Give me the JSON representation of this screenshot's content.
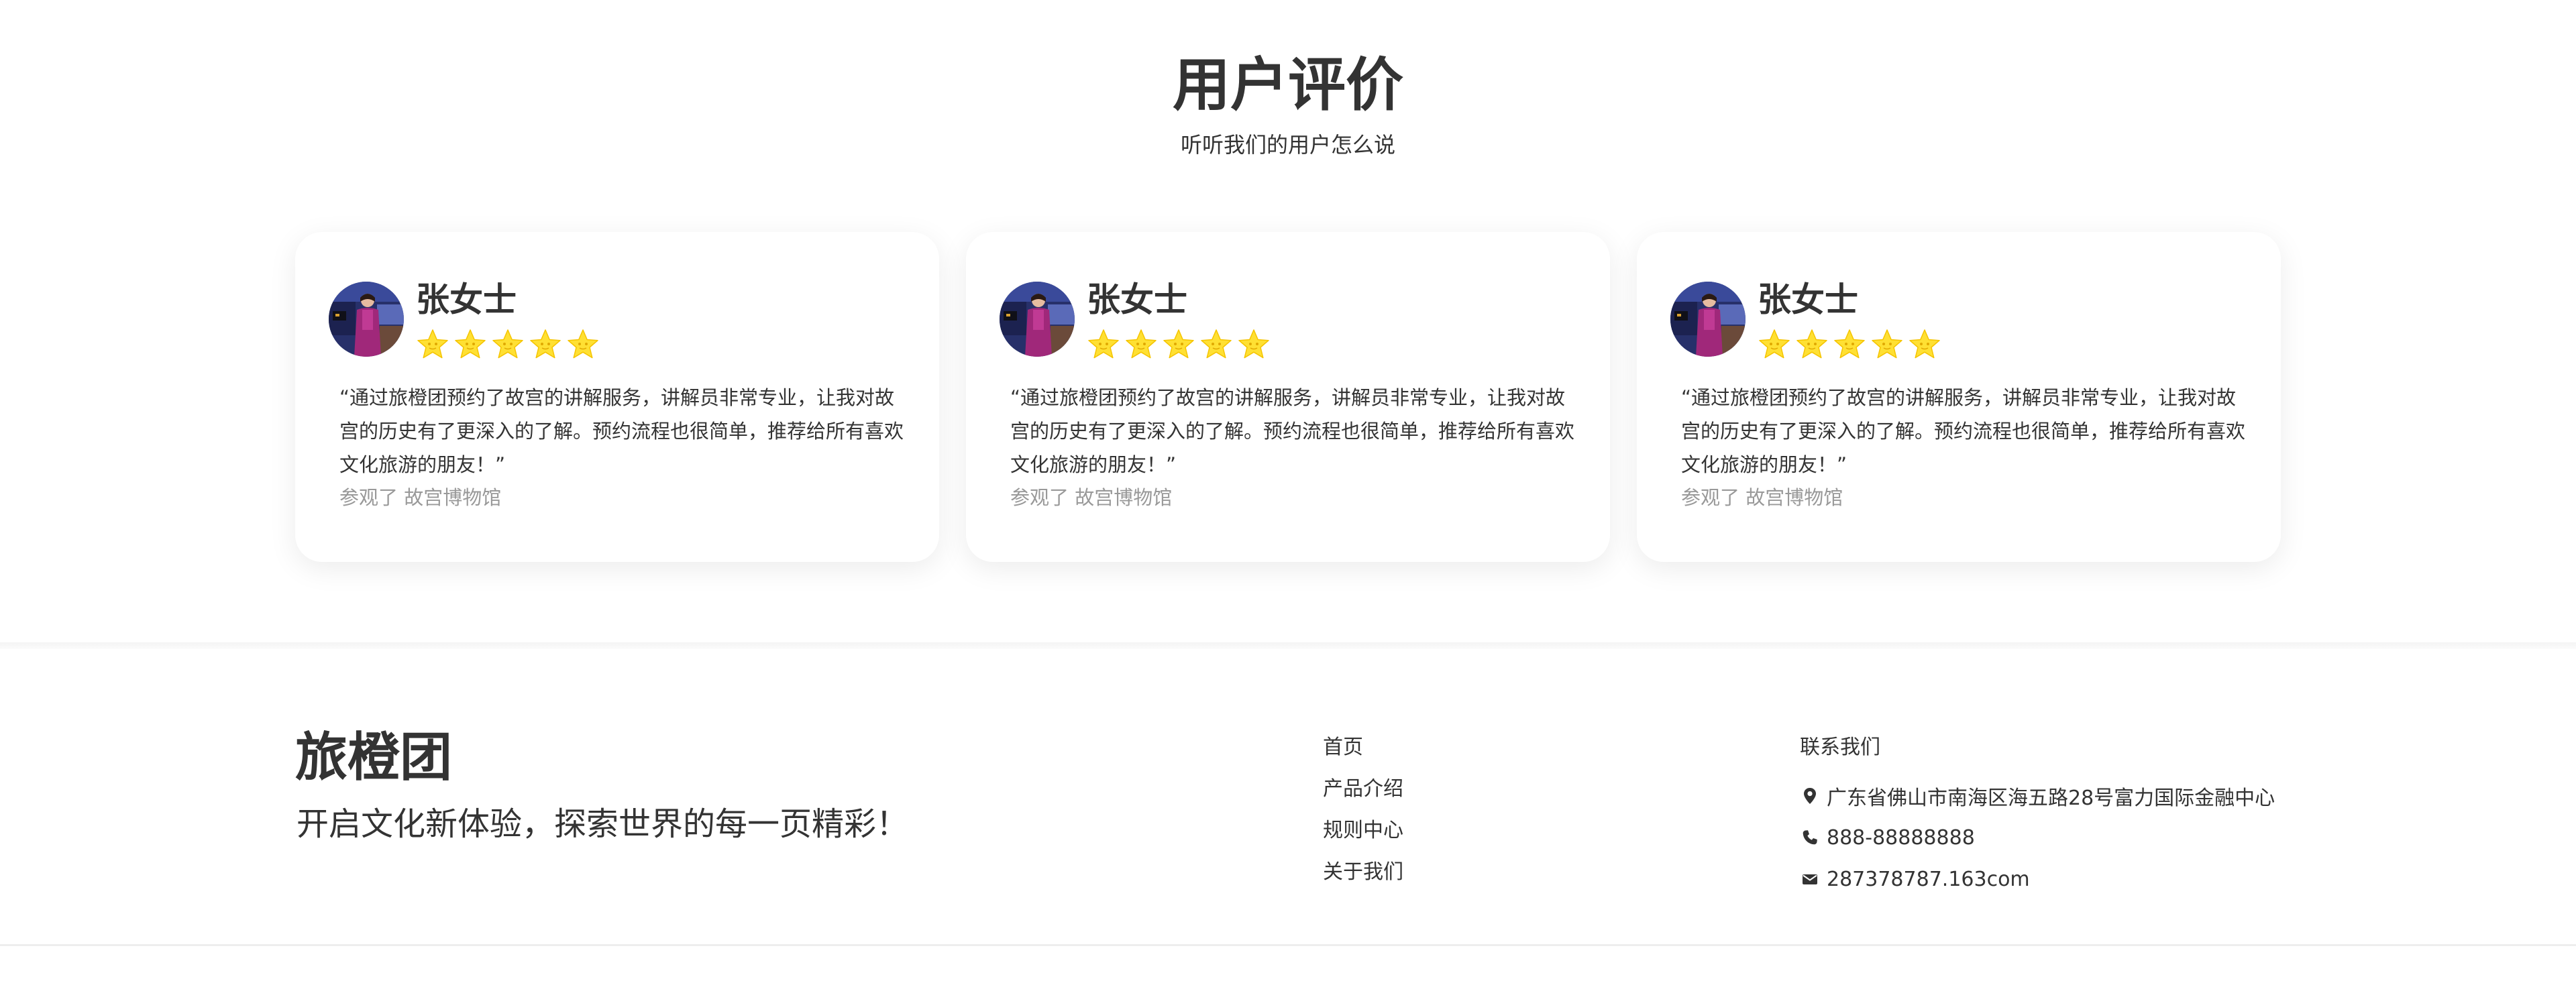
{
  "section": {
    "title": "用户评价",
    "subtitle": "听听我们的用户怎么说"
  },
  "reviews": [
    {
      "name": "张女士",
      "rating": 5,
      "text": "“通过旅橙团预约了故宫的讲解服务，讲解员非常专业，让我对故宫的历史有了更深入的了解。预约流程也很简单，推荐给所有喜欢文化旅游的朋友！”",
      "visited": "参观了 故宫博物馆"
    },
    {
      "name": "张女士",
      "rating": 5,
      "text": "“通过旅橙团预约了故宫的讲解服务，讲解员非常专业，让我对故宫的历史有了更深入的了解。预约流程也很简单，推荐给所有喜欢文化旅游的朋友！”",
      "visited": "参观了 故宫博物馆"
    },
    {
      "name": "张女士",
      "rating": 5,
      "text": "“通过旅橙团预约了故宫的讲解服务，讲解员非常专业，让我对故宫的历史有了更深入的了解。预约流程也很简单，推荐给所有喜欢文化旅游的朋友！”",
      "visited": "参观了 故宫博物馆"
    }
  ],
  "footer": {
    "brand": "旅橙团",
    "slogan": "开启文化新体验，探索世界的每一页精彩！",
    "nav": [
      "首页",
      "产品介绍",
      "规则中心",
      "关于我们"
    ],
    "contact": {
      "heading": "联系我们",
      "address": "广东省佛山市南海区海五路28号富力国际金融中心",
      "phone": "888-88888888",
      "email": "287378787.163com"
    }
  },
  "colors": {
    "star": "#FFE033",
    "text": "#333333",
    "muted": "#999999"
  },
  "icons": {
    "address": "map-pin-icon",
    "phone": "phone-icon",
    "email": "envelope-icon",
    "rating": "star-icon"
  }
}
